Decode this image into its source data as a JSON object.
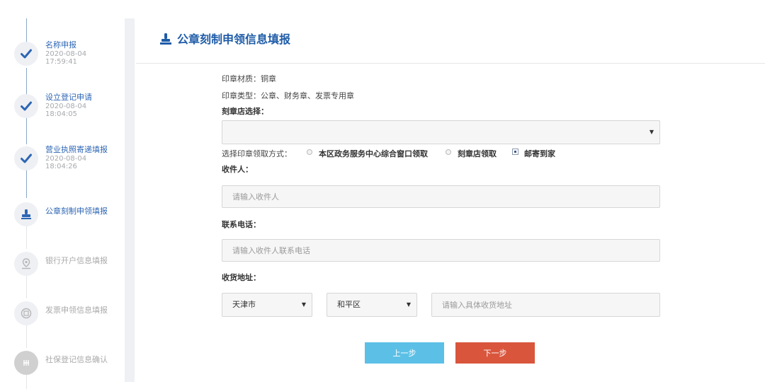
{
  "steps": [
    {
      "title": "名称申报",
      "time": [
        "2020-08-04",
        "17:59:41"
      ],
      "status": "done",
      "icon": "check-icon"
    },
    {
      "title": "设立登记申请",
      "time": [
        "2020-08-04",
        "18:04:05"
      ],
      "status": "done",
      "icon": "check-icon"
    },
    {
      "title": "营业执照寄递填报",
      "time": [
        "2020-08-04",
        "18:04:26"
      ],
      "status": "done",
      "icon": "check-icon"
    },
    {
      "title": "公章刻制申领填报",
      "status": "current",
      "icon": "stamp-icon"
    },
    {
      "title": "银行开户信息填报",
      "status": "todo",
      "icon": "location-pin-icon"
    },
    {
      "title": "发票申领信息填报",
      "status": "todo",
      "icon": "invoice-icon"
    },
    {
      "title": "社保登记信息确认",
      "status": "todo",
      "icon": "social-security-icon"
    }
  ],
  "header": {
    "title": "公章刻制申领信息填报",
    "icon": "stamp-icon"
  },
  "form": {
    "material": "印章材质：铜章",
    "seal_types": "印章类型：公章、财务章、发票专用章",
    "shop_label": "刻章店选择：",
    "shop_value": "",
    "pickup": {
      "label": "选择印章领取方式：",
      "options": [
        "本区政务服务中心综合窗口领取",
        "刻章店领取",
        "邮寄到家"
      ],
      "selected": "邮寄到家"
    },
    "recipient_label": "收件人：",
    "recipient_placeholder": "请输入收件人",
    "phone_label": "联系电话：",
    "phone_placeholder": "请输入收件人联系电话",
    "address_label": "收货地址：",
    "city": "天津市",
    "district": "和平区",
    "address_placeholder": "请输入具体收货地址"
  },
  "buttons": {
    "prev": "上一步",
    "next": "下一步"
  },
  "colors": {
    "accent": "#1f5ca8",
    "prev_button": "#5cc0e6",
    "next_button": "#d9563d"
  }
}
